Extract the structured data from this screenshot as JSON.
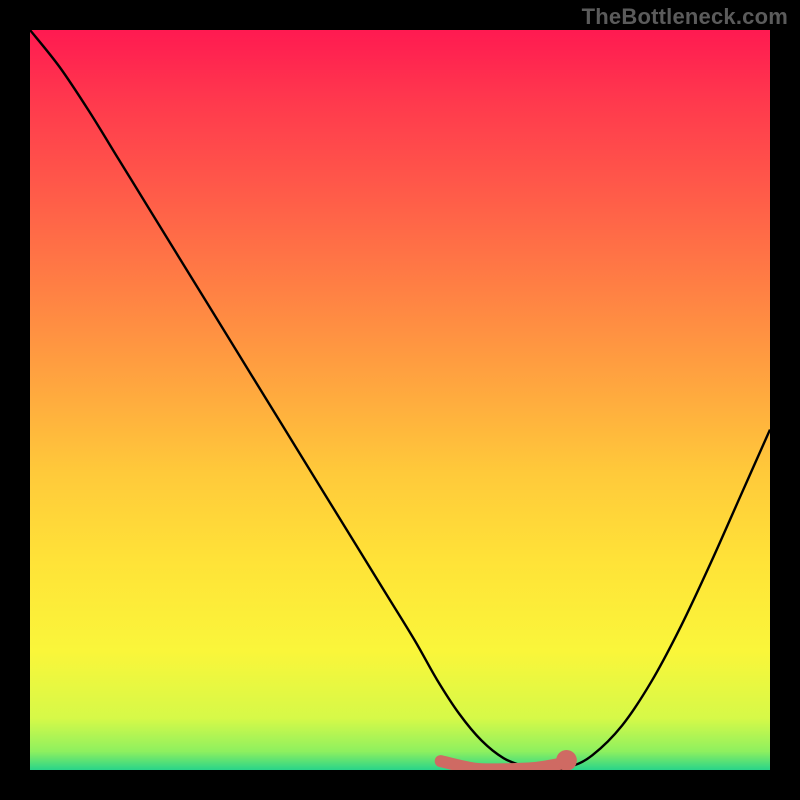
{
  "watermark": "TheBottleneck.com",
  "chart_data": {
    "type": "line",
    "title": "",
    "xlabel": "",
    "ylabel": "",
    "xlim": [
      0,
      100
    ],
    "ylim": [
      0,
      100
    ],
    "grid": false,
    "series": [
      {
        "name": "curve",
        "color": "#000000",
        "x": [
          0,
          4,
          8,
          12,
          16,
          20,
          24,
          28,
          32,
          36,
          40,
          44,
          48,
          52,
          55,
          58,
          61,
          64,
          67,
          70,
          73,
          76,
          80,
          84,
          88,
          92,
          96,
          100
        ],
        "y": [
          100,
          95,
          89,
          82.5,
          76,
          69.5,
          63,
          56.5,
          50,
          43.5,
          37,
          30.5,
          24,
          17.5,
          12.2,
          7.6,
          4.0,
          1.6,
          0.45,
          0.02,
          0.45,
          2.0,
          6.0,
          12.0,
          19.5,
          28.0,
          37.0,
          46.0
        ]
      }
    ],
    "marker_group": {
      "color": "#cf6a63",
      "points_x": [
        55.5,
        60,
        64,
        68,
        72
      ],
      "points_y": [
        1.2,
        0.2,
        0.1,
        0.25,
        0.9
      ],
      "end_dot": {
        "x": 72.5,
        "y": 1.3,
        "r": 1.4
      }
    },
    "background_gradient": {
      "stops": [
        {
          "offset": 0.0,
          "color": "#ff1a51"
        },
        {
          "offset": 0.1,
          "color": "#ff3a4d"
        },
        {
          "offset": 0.22,
          "color": "#ff5b49"
        },
        {
          "offset": 0.35,
          "color": "#ff8044"
        },
        {
          "offset": 0.48,
          "color": "#ffa63f"
        },
        {
          "offset": 0.6,
          "color": "#ffca3a"
        },
        {
          "offset": 0.72,
          "color": "#ffe338"
        },
        {
          "offset": 0.84,
          "color": "#faf63a"
        },
        {
          "offset": 0.93,
          "color": "#d6f948"
        },
        {
          "offset": 0.975,
          "color": "#8ef05f"
        },
        {
          "offset": 1.0,
          "color": "#29d48a"
        }
      ]
    }
  }
}
